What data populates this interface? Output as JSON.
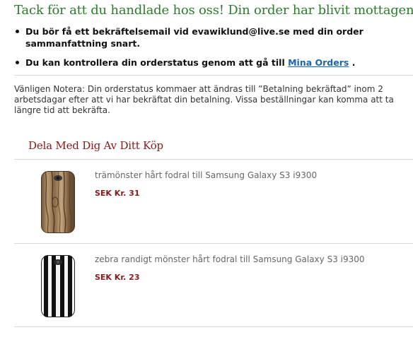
{
  "confirmation": {
    "heading": "Tack för att du handlade hos oss! Din order har blivit mottagen!",
    "bullets": [
      {
        "text": "Du bör få ett bekräftelsemail vid evawiklund@live.se med din order sammanfattning snart."
      },
      {
        "text_before": "Du kan kontrollera din orderstatus genom att gå till",
        "link_label": "Mina Orders",
        "text_after": "."
      }
    ],
    "notice": "Vänligen Notera: Din orderstatus kommaer att ändras till ”Betalning bekräftad” inom 2 arbetsdagar efter att vi har bekräftat din betalning. Vissa beställningar kan komma att ta längre tid att bekräfta."
  },
  "share": {
    "title": "Dela Med Dig Av Ditt Köp",
    "products": [
      {
        "name": "trämönster hårt fodral till Samsung Galaxy S3 i9300",
        "price": "SEK Kr. 31",
        "image_icon": "wood-grain-phone-case"
      },
      {
        "name": "zebra randigt mönster hårt fodral till Samsung Galaxy S3 i9300",
        "price": "SEK Kr. 23",
        "image_icon": "zebra-stripe-phone-case"
      }
    ]
  },
  "colors": {
    "heading_green": "#2b7d2b",
    "link_blue": "#1a66b3",
    "price_red": "#8a1a1a",
    "share_title_red": "#8a1a1a"
  }
}
